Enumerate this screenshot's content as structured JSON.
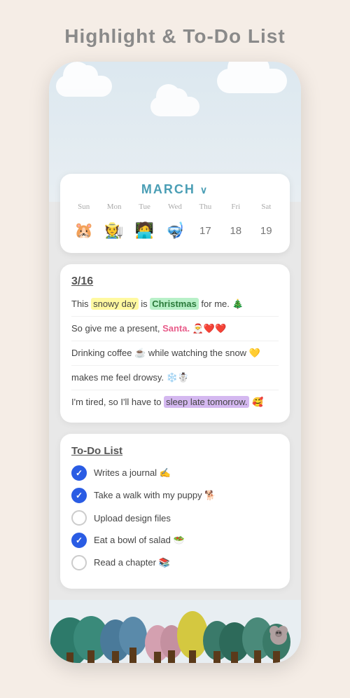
{
  "title": "Highlight & To-Do List",
  "phone": {
    "calendar": {
      "month": "MARCH",
      "weekdays": [
        "Sun",
        "Mon",
        "Tue",
        "Wed",
        "Thu",
        "Fri",
        "Sat"
      ],
      "cells": [
        {
          "type": "emoji",
          "value": "🐹"
        },
        {
          "type": "emoji",
          "value": "🧑‍🌾"
        },
        {
          "type": "emoji",
          "value": "🧑‍💻"
        },
        {
          "type": "emoji",
          "value": "🤿"
        },
        {
          "type": "number",
          "value": "17"
        },
        {
          "type": "number",
          "value": "18"
        },
        {
          "type": "number",
          "value": "19"
        }
      ]
    },
    "journal": {
      "date": "3/16",
      "lines": [
        {
          "text": "This snowy day is Christmas for me. 🎄",
          "parts": [
            {
              "text": "This ",
              "style": "normal"
            },
            {
              "text": "snowy day",
              "style": "highlight-yellow"
            },
            {
              "text": " is ",
              "style": "normal"
            },
            {
              "text": "Christmas",
              "style": "highlight-green"
            },
            {
              "text": " for me. 🎄",
              "style": "normal"
            }
          ]
        },
        {
          "text": "So give me a present, Santa. 🎅❤️❤️",
          "parts": [
            {
              "text": "So give me a present, ",
              "style": "normal"
            },
            {
              "text": "Santa.",
              "style": "highlight-pink"
            },
            {
              "text": " 🎅❤️❤️",
              "style": "normal"
            }
          ]
        },
        {
          "text": "Drinking coffee ☕ while watching the snow 💛"
        },
        {
          "text": "makes me feel drowsy. ❄️☃️"
        },
        {
          "text": "I'm tired, so I'll have to sleep late tomorrow. 🥰",
          "parts": [
            {
              "text": "I'm tired, so I'll have to ",
              "style": "normal"
            },
            {
              "text": "sleep late tomorrow.",
              "style": "highlight-purple"
            },
            {
              "text": " 🥰",
              "style": "normal"
            }
          ]
        }
      ]
    },
    "todo": {
      "heading": "To-Do List",
      "items": [
        {
          "text": "Writes a journal ✍️",
          "checked": true
        },
        {
          "text": "Take a walk with my puppy 🐕",
          "checked": true
        },
        {
          "text": "Upload design files",
          "checked": false
        },
        {
          "text": "Eat a bowl of salad 🥗",
          "checked": true
        },
        {
          "text": "Read a chapter 📚",
          "checked": false
        }
      ]
    }
  }
}
